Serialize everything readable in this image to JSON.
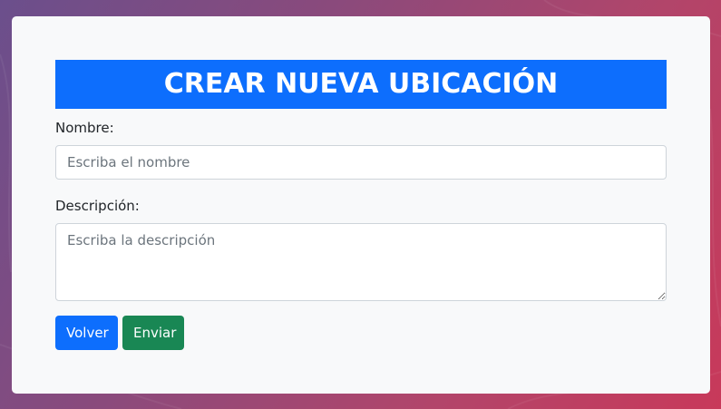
{
  "form": {
    "title": "CREAR NUEVA UBICACIÓN",
    "name_label": "Nombre:",
    "name_placeholder": "Escriba el nombre",
    "name_value": "",
    "description_label": "Descripción:",
    "description_placeholder": "Escriba la descripción",
    "description_value": "",
    "back_label": "Volver",
    "submit_label": "Enviar"
  },
  "colors": {
    "primary": "#0d6efd",
    "success": "#198754",
    "card_background": "#f8f9fa",
    "page_gradient_start": "#6b4f8c",
    "page_gradient_end": "#c8395a"
  }
}
